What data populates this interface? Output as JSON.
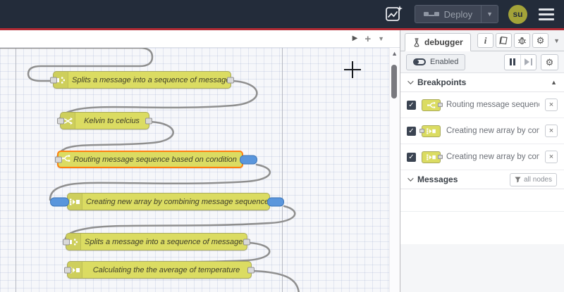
{
  "header": {
    "deploy_label": "Deploy",
    "avatar_text": "su",
    "icons": [
      "flow-export-assistant-icon",
      "deploy-nodes-icon",
      "dropdown-caret-icon",
      "hamburger-menu-icon"
    ],
    "colors": {
      "header_bg": "#232c3a",
      "accent_red": "#b12b34",
      "avatar_bg": "#a3a339"
    }
  },
  "canvas": {
    "colors": {
      "node_fill": "#dbdc62",
      "node_border": "#a9aa5e",
      "selected_border": "#ff7f0e",
      "breakpoint_blue": "#5a96dc",
      "wire": "#8f8f8f"
    },
    "strip_buttons": [
      "scroll-tabs-right",
      "add-flow",
      "flow-list"
    ],
    "nodes": [
      {
        "type": "split",
        "label": "Splits a message into a sequence of messages."
      },
      {
        "type": "change",
        "label": "Kelvin to celcius"
      },
      {
        "type": "switch",
        "label": "Routing message sequence based on condition",
        "selected": true,
        "breakpoint_out": true
      },
      {
        "type": "join",
        "label": "Creating new array by combining message sequence",
        "breakpoint_in": true,
        "breakpoint_out": true
      },
      {
        "type": "split",
        "label": "Splits a message into a sequence of messages."
      },
      {
        "type": "join",
        "label": "Calculating the the average of temperature"
      }
    ]
  },
  "sidebar": {
    "tab_label": "debugger",
    "tab_icons": [
      "flask-icon",
      "info-icon",
      "book-icon",
      "bug-icon",
      "gear-icon",
      "caret-down-icon"
    ],
    "enabled_label": "Enabled",
    "toolbar_icons": [
      "toggle-icon",
      "pause-icon",
      "step-forward-icon",
      "gear-icon"
    ],
    "breakpoints": {
      "title": "Breakpoints",
      "items": [
        {
          "checked": true,
          "node_type": "switch",
          "port_side": "right",
          "label": "Routing message sequence based on condition"
        },
        {
          "checked": true,
          "node_type": "join",
          "port_side": "left",
          "label": "Creating new array by combining message sequence"
        },
        {
          "checked": true,
          "node_type": "join",
          "port_side": "right",
          "label": "Creating new array by combining message sequence"
        }
      ]
    },
    "messages": {
      "title": "Messages",
      "filter_label": "all nodes"
    }
  }
}
